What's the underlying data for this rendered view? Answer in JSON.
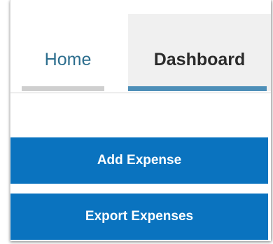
{
  "tabs": [
    {
      "label": "Home",
      "active": false
    },
    {
      "label": "Dashboard",
      "active": true
    }
  ],
  "actions": {
    "add_expense_label": "Add Expense",
    "export_expenses_label": "Export Expenses"
  },
  "colors": {
    "button_bg": "#0a73bf",
    "active_tab_underline": "#4e8fb8",
    "inactive_tab_underline": "#cfcfcf",
    "home_tab_text": "#2d6e8e",
    "dashboard_tab_bg": "#f0f0f0"
  }
}
